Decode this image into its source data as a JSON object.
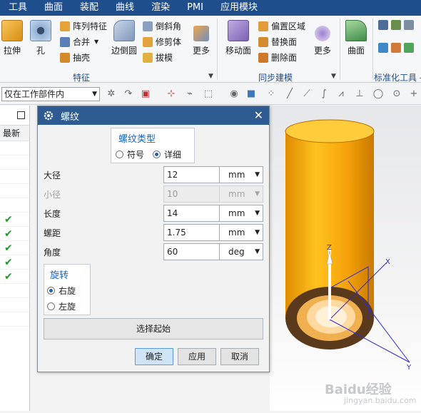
{
  "menu": [
    "工具",
    "曲面",
    "装配",
    "曲线",
    "渲染",
    "PMI",
    "应用模块"
  ],
  "ribbon": {
    "feature_group": {
      "label": "特征",
      "big": [
        "拉伸",
        "孔",
        "边倒圆"
      ],
      "small": [
        "阵列特征",
        "合并",
        "抽壳",
        "倒斜角",
        "修剪体",
        "拔模"
      ],
      "more": "更多"
    },
    "sync_group": {
      "label": "同步建模",
      "big": [
        "移动面"
      ],
      "small": [
        "偏置区域",
        "替换面",
        "删除面"
      ],
      "more": "更多"
    },
    "surface_group": {
      "big": [
        "曲面"
      ]
    },
    "std_group": {
      "label": "标准化工具 - G"
    },
    "more_label": "更多"
  },
  "toolbar": {
    "select_filter": "仅在工作部件内"
  },
  "nav": {
    "column_header": "最新",
    "checks": [
      5,
      6,
      7,
      8,
      9
    ]
  },
  "dialog": {
    "title": "螺纹",
    "thread_type": {
      "header": "螺纹类型",
      "options": [
        "符号",
        "详细"
      ],
      "selected": "详细"
    },
    "fields": [
      {
        "label": "大径",
        "value": "12",
        "unit": "mm",
        "enabled": true
      },
      {
        "label": "小径",
        "value": "10",
        "unit": "mm",
        "enabled": false
      },
      {
        "label": "长度",
        "value": "14",
        "unit": "mm",
        "enabled": true
      },
      {
        "label": "螺距",
        "value": "1.75",
        "unit": "mm",
        "enabled": true
      },
      {
        "label": "角度",
        "value": "60",
        "unit": "deg",
        "enabled": true
      }
    ],
    "rotation": {
      "header": "旋转",
      "options": [
        "右旋",
        "左旋"
      ],
      "selected": "右旋"
    },
    "select_start": "选择起始",
    "buttons": {
      "ok": "确定",
      "apply": "应用",
      "cancel": "取消"
    }
  },
  "viewport": {
    "axes": [
      "Z",
      "X",
      "Y"
    ],
    "part_color": "#f5a20a"
  },
  "watermark": {
    "main": "Baidu经验",
    "sub": "jingyan.baidu.com"
  }
}
